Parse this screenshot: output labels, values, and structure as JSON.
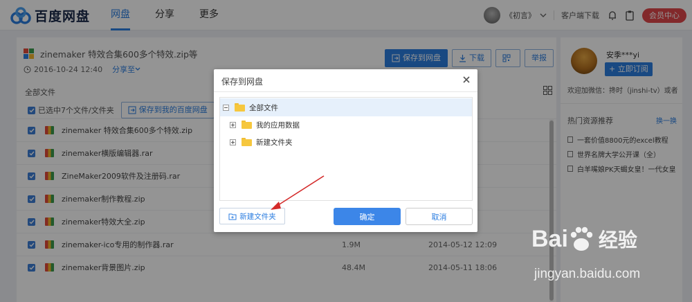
{
  "header": {
    "logo_text": "百度网盘",
    "nav": [
      {
        "label": "网盘"
      },
      {
        "label": "分享"
      },
      {
        "label": "更多"
      }
    ],
    "username": "《初言》",
    "client_download": "客户端下载",
    "vip_center": "会员中心"
  },
  "file": {
    "title": "zinemaker 特效合集600多个特效.zip等",
    "date": "2016-10-24 12:40",
    "share_to": "分享至",
    "save_button": "保存到网盘",
    "download_button": "下载",
    "report_button": "举报",
    "breadcrumb": "全部文件",
    "selection_text": "已选中7个文件/文件夹",
    "save_to_my_button": "保存到我的百度网盘"
  },
  "files": [
    {
      "name": "zinemaker 特效合集600多个特效.zip",
      "size": "",
      "date": ""
    },
    {
      "name": "zinemaker横版编辑器.rar",
      "size": "",
      "date": ""
    },
    {
      "name": "ZineMaker2009软件及注册码.rar",
      "size": "",
      "date": ""
    },
    {
      "name": "zinemaker制作教程.zip",
      "size": "",
      "date": ""
    },
    {
      "name": "zinemaker特效大全.zip",
      "size": "",
      "date": ""
    },
    {
      "name": "zinemaker-ico专用的制作器.rar",
      "size": "1.9M",
      "date": "2014-05-12 12:09"
    },
    {
      "name": "zinemaker背景图片.zip",
      "size": "48.4M",
      "date": "2014-05-11 18:06"
    }
  ],
  "sidebar": {
    "name": "安季***yi",
    "subscribe_button": "+ 立即订阅",
    "description": "欢迎加微信：搀时（jinshi-tv）或者",
    "hot_title": "热门资源推荐",
    "hot_more": "换一换",
    "hot_items": [
      {
        "label": "一套价值8800元的excel教程"
      },
      {
        "label": "世界名牌大学公开课（全）"
      },
      {
        "label": "白羊嘴娘PK天蝎女皇！一代女皇"
      }
    ]
  },
  "dialog": {
    "title": "保存到网盘",
    "tree": [
      {
        "label": "全部文件"
      },
      {
        "label": "我的应用数据"
      },
      {
        "label": "新建文件夹"
      }
    ],
    "new_folder_button": "新建文件夹",
    "ok_button": "确定",
    "cancel_button": "取消"
  },
  "watermark": {
    "brand": "Bai",
    "brand_suffix": "经验",
    "url": "jingyan.baidu.com"
  },
  "colors": {
    "accent": "#2c7ee0",
    "vip": "#e1484a",
    "arrow": "#d42a2a"
  }
}
